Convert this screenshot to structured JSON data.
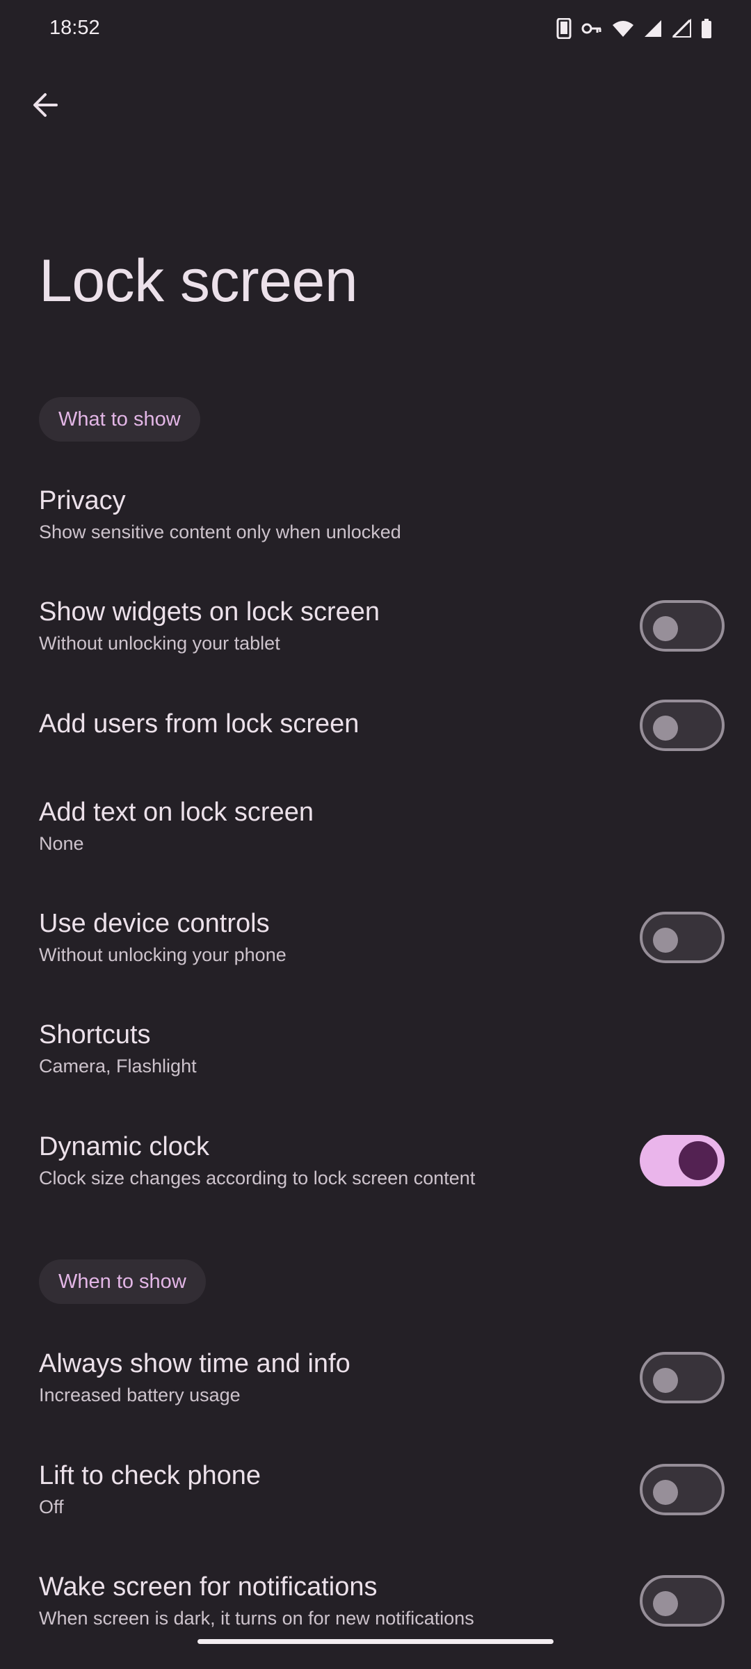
{
  "status": {
    "time": "18:52",
    "icons": [
      "phone-icon",
      "vpn-key-icon",
      "wifi-icon",
      "signal-icon",
      "no-data-icon",
      "battery-icon"
    ]
  },
  "header": {
    "back_icon": "arrow-back-icon",
    "title": "Lock screen"
  },
  "sections": {
    "what": "What to show",
    "when": "When to show"
  },
  "items": [
    {
      "title": "Privacy",
      "subtitle": "Show sensitive content only when unlocked",
      "toggle": null
    },
    {
      "title": "Show widgets on lock screen",
      "subtitle": "Without unlocking your tablet",
      "toggle": "off"
    },
    {
      "title": "Add users from lock screen",
      "subtitle": "",
      "toggle": "off"
    },
    {
      "title": "Add text on lock screen",
      "subtitle": "None",
      "toggle": null
    },
    {
      "title": "Use device controls",
      "subtitle": "Without unlocking your phone",
      "toggle": "off"
    },
    {
      "title": "Shortcuts",
      "subtitle": "Camera, Flashlight",
      "toggle": null
    },
    {
      "title": "Dynamic clock",
      "subtitle": "Clock size changes according to lock screen content",
      "toggle": "on"
    },
    {
      "title": "Always show time and info",
      "subtitle": "Increased battery usage",
      "toggle": "off"
    },
    {
      "title": "Lift to check phone",
      "subtitle": "Off",
      "toggle": "off"
    },
    {
      "title": "Wake screen for notifications",
      "subtitle": "When screen is dark, it turns on for new notifications",
      "toggle": "off"
    }
  ],
  "colors": {
    "background": "#242026",
    "accent": "#EAB5EB",
    "chip_bg": "#322D34",
    "chip_text": "#E3B6E6"
  }
}
